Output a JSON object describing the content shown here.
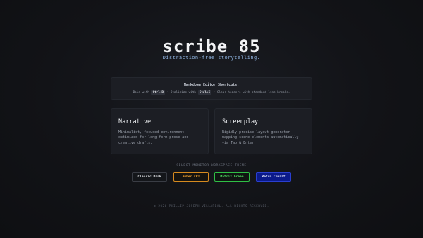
{
  "app": {
    "title": "scribe 85",
    "tagline": "Distraction-free storytelling."
  },
  "shortcuts": {
    "title": "Markdown Editor Shortcuts:",
    "bold_prefix": "Bold with",
    "bold_key": "Ctrl+B",
    "italic_prefix": "• Italicize with",
    "italic_key": "Ctrl+I",
    "clear_text": "• Clear headers with standard line breaks."
  },
  "modes": [
    {
      "title": "Narrative",
      "description": "Minimalist, focused environment optimized for long-form prose and creative drafts."
    },
    {
      "title": "Screenplay",
      "description": "Rigidly precise layout generator mapping scene elements automatically via Tab & Enter."
    }
  ],
  "themes": {
    "label": "SELECT MONITOR WORKSPACE THEME",
    "options": [
      "Classic Dark",
      "Amber CRT",
      "Matrix Green",
      "Retro Cobalt"
    ],
    "colors": {
      "classic": "#3a3d45",
      "amber": "#d68a1f",
      "matrix": "#2fbf45",
      "cobalt": "#0b1a8a"
    }
  },
  "footer": {
    "text": "© 2026 PHILLIP JOSEPH VILLAREAL. ALL RIGHTS RESERVED."
  }
}
